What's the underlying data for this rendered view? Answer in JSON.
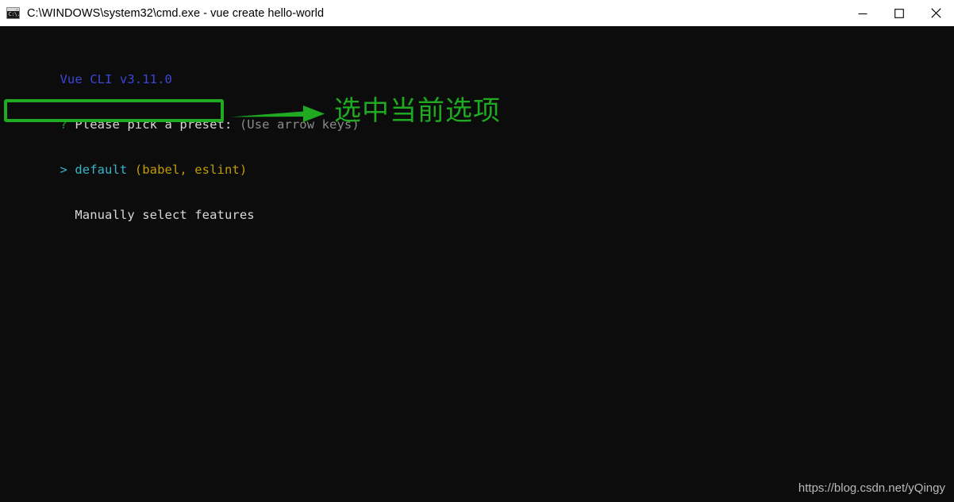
{
  "window": {
    "title": "C:\\WINDOWS\\system32\\cmd.exe - vue  create hello-world",
    "icon": "cmd-console-icon",
    "icon_glyph": "C:\\.",
    "titlebar_bg": "#ffffff",
    "titlebar_fg": "#000000",
    "terminal_bg": "#0c0c0c",
    "controls": {
      "minimize": "minimize-icon",
      "maximize": "maximize-icon",
      "close": "close-icon"
    }
  },
  "terminal": {
    "lines": [
      {
        "id": "line-version",
        "segments": [
          {
            "text": "Vue CLI v3.11.0",
            "color": "#3b47d8",
            "class": "c-blue"
          }
        ]
      },
      {
        "id": "line-prompt",
        "segments": [
          {
            "text": "? ",
            "color": "#19a31a",
            "class": "c-green"
          },
          {
            "text": "Please pick a preset: ",
            "color": "#d8d8d8",
            "class": "c-white"
          },
          {
            "text": "(Use arrow keys)",
            "color": "#8a8a8a",
            "class": "c-dim"
          }
        ]
      },
      {
        "id": "line-option-default",
        "segments": [
          {
            "text": "> default ",
            "color": "#35b5c9",
            "class": "c-cyan"
          },
          {
            "text": "(babel, eslint)",
            "color": "#c19c00",
            "class": "c-yellow"
          }
        ]
      },
      {
        "id": "line-option-manual",
        "segments": [
          {
            "text": "  Manually select features",
            "color": "#d8d8d8",
            "class": "c-white"
          }
        ]
      }
    ]
  },
  "annotations": {
    "highlight_color": "#1faa22",
    "highlight_target": "Manually select features",
    "arrow": "right-arrow-annotation",
    "note_text": "选中当前选项"
  },
  "watermark": {
    "text": "https://blog.csdn.net/yQingy",
    "color": "#b9b9b9"
  }
}
